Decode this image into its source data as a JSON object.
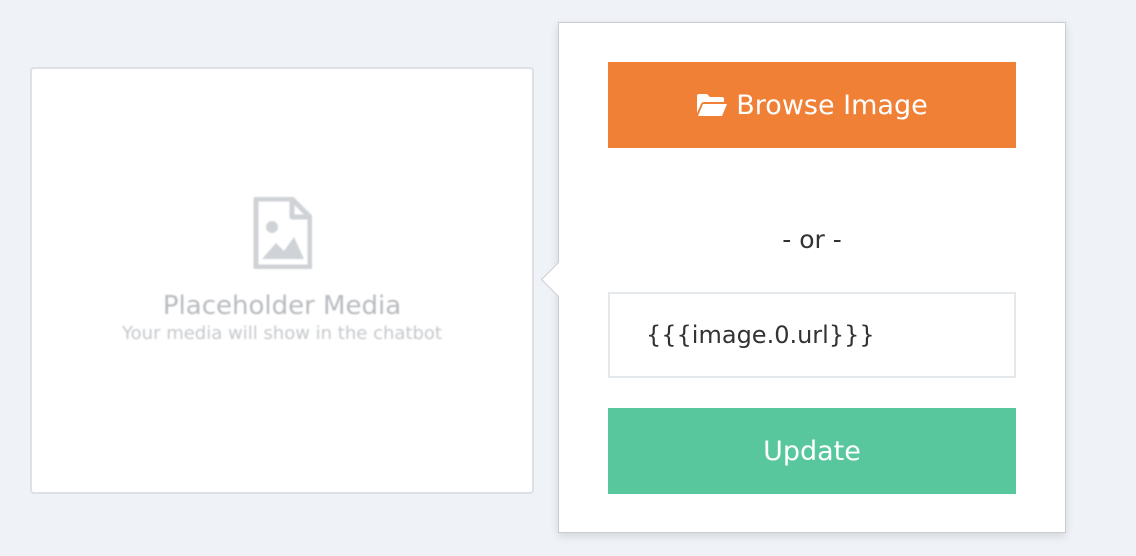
{
  "media": {
    "icon": "image-file-icon",
    "title": "Placeholder Media",
    "subtitle": "Your media will show in the chatbot"
  },
  "popover": {
    "browse_label": "Browse Image",
    "browse_icon": "folder-open-icon",
    "or_text": "- or -",
    "url_value": "{{{image.0.url}}}",
    "update_label": "Update"
  },
  "colors": {
    "browse": "#f08036",
    "update": "#58c79d",
    "background": "#eff2f7"
  }
}
